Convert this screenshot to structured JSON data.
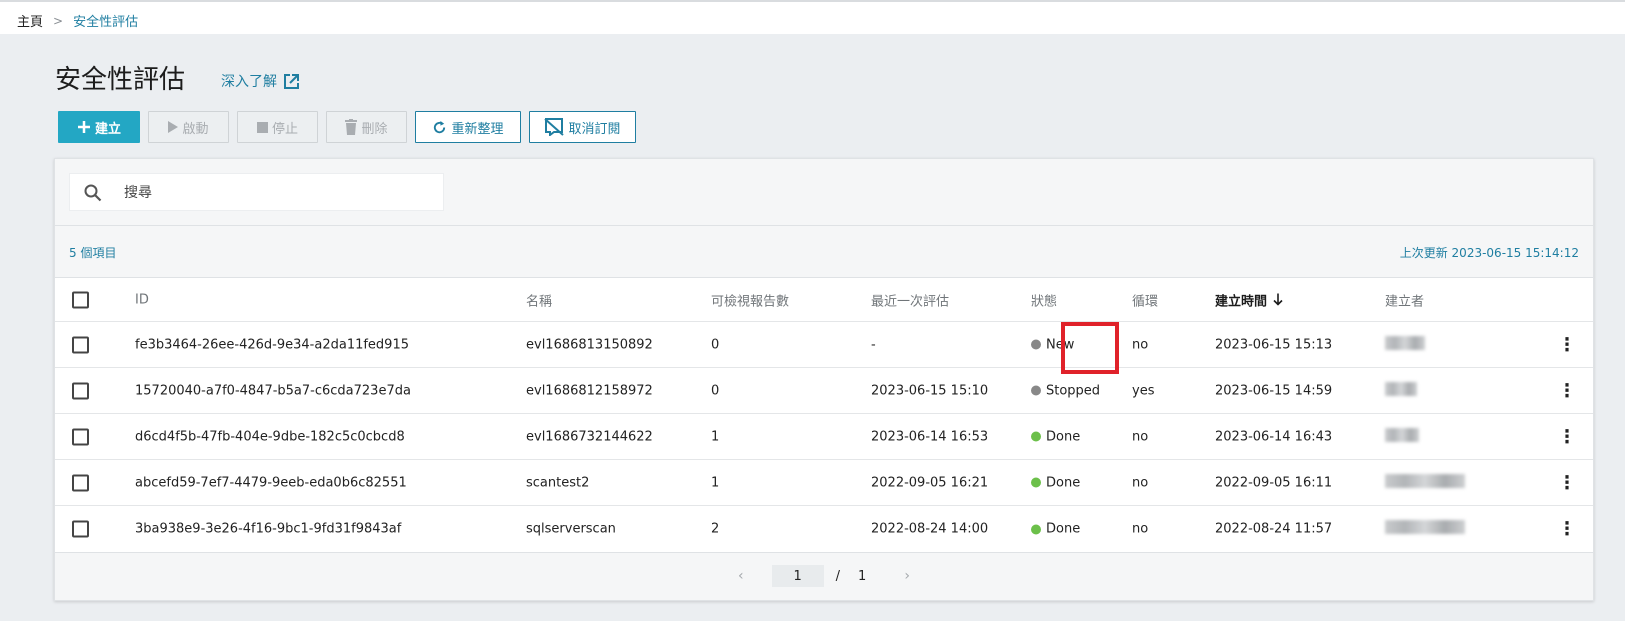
{
  "breadcrumb": {
    "home": "主頁",
    "separator": ">",
    "current": "安全性評估"
  },
  "page": {
    "title": "安全性評估",
    "learn_more": "深入了解"
  },
  "toolbar": {
    "create": "建立",
    "start": "啟動",
    "stop": "停止",
    "delete": "刪除",
    "refresh": "重新整理",
    "unsubscribe": "取消訂閱"
  },
  "search": {
    "placeholder": "搜尋"
  },
  "summary": {
    "count": "5 個項目",
    "last_updated": "上次更新 2023-06-15 15:14:12"
  },
  "table": {
    "headers": {
      "id": "ID",
      "name": "名稱",
      "reports": "可檢視報告數",
      "last_eval": "最近一次評估",
      "status": "狀態",
      "loop": "循環",
      "created": "建立時間",
      "creator": "建立者"
    },
    "rows": [
      {
        "id": "fe3b3464-26ee-426d-9e34-a2da11fed915",
        "name": "evl1686813150892",
        "reports": "0",
        "last_eval": "-",
        "status": "New",
        "status_color": "#888888",
        "loop": "no",
        "created": "2023-06-15 15:13"
      },
      {
        "id": "15720040-a7f0-4847-b5a7-c6cda723e7da",
        "name": "evl1686812158972",
        "reports": "0",
        "last_eval": "2023-06-15 15:10",
        "status": "Stopped",
        "status_color": "#888888",
        "loop": "yes",
        "created": "2023-06-15 14:59"
      },
      {
        "id": "d6cd4f5b-47fb-404e-9dbe-182c5c0cbcd8",
        "name": "evl1686732144622",
        "reports": "1",
        "last_eval": "2023-06-14 16:53",
        "status": "Done",
        "status_color": "#6cc04a",
        "loop": "no",
        "created": "2023-06-14 16:43"
      },
      {
        "id": "abcefd59-7ef7-4479-9eeb-eda0b6c82551",
        "name": "scantest2",
        "reports": "1",
        "last_eval": "2022-09-05 16:21",
        "status": "Done",
        "status_color": "#6cc04a",
        "loop": "no",
        "created": "2022-09-05 16:11"
      },
      {
        "id": "3ba938e9-3e26-4f16-9bc1-9fd31f9843af",
        "name": "sqlserverscan",
        "reports": "2",
        "last_eval": "2022-08-24 14:00",
        "status": "Done",
        "status_color": "#6cc04a",
        "loop": "no",
        "created": "2022-08-24 11:57"
      }
    ]
  },
  "pager": {
    "current": "1",
    "separator": "/",
    "total": "1"
  },
  "colors": {
    "accent": "#23a7c4",
    "link": "#1f7ea1",
    "highlight": "#e0222a"
  }
}
